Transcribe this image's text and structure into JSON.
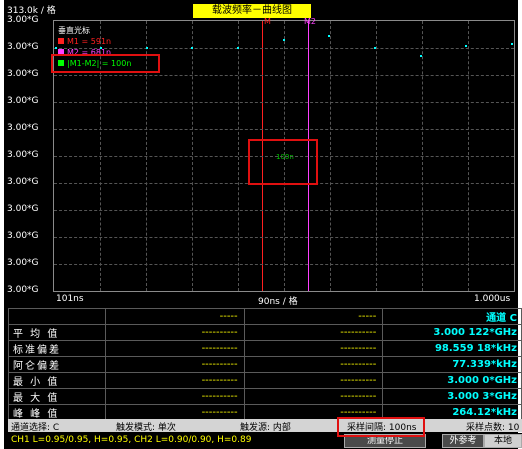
{
  "header": {
    "scale": "313.0k / 格",
    "title": "载波频率－曲线图"
  },
  "plot": {
    "y_tick_label": "3.00*G",
    "y_tick_count": 11,
    "x_ticks": {
      "left": "101ns",
      "center": "90ns / 格",
      "right": "1.000us"
    },
    "legend": {
      "title": "垂直光标",
      "items": [
        {
          "label": "M1 = 591n",
          "color": "#ff2020"
        },
        {
          "label": "M2 = 681n",
          "color": "#ff40ff"
        },
        {
          "label": "|M1-M2| = 100n",
          "color": "#00ff00"
        }
      ]
    },
    "delta_label": "100n",
    "marker_colors": {
      "m1": "#ff2020",
      "m2": "#ff40ff",
      "dots": "#00ffff"
    },
    "marker_tags": {
      "m1": "M",
      "m2": "M2"
    }
  },
  "chart_data": {
    "type": "scatter",
    "x": [
      101,
      190,
      280,
      370,
      460,
      550,
      640,
      730,
      820,
      910,
      1000
    ],
    "y": [
      3.000122,
      3.000122,
      3.000122,
      3.000122,
      3.000122,
      3.000126,
      3.000128,
      3.000122,
      3.000118,
      3.000123,
      3.000124
    ],
    "xlabel": "90ns / 格",
    "ylim": [
      3.0,
      3.000135
    ],
    "xlim": [
      101,
      1000
    ],
    "grid": true
  },
  "stats": {
    "channel_header": "通道 C",
    "rows": [
      {
        "label": "平 均 值",
        "c1": "----------",
        "c2": "----------",
        "c3": "3.000 122*GHz"
      },
      {
        "label": "标准偏差",
        "c1": "----------",
        "c2": "----------",
        "c3": "98.559 18*kHz"
      },
      {
        "label": "阿仑偏差",
        "c1": "----------",
        "c2": "----------",
        "c3": "77.339*kHz"
      },
      {
        "label": "最 小 值",
        "c1": "----------",
        "c2": "----------",
        "c3": "3.000 0*GHz"
      },
      {
        "label": "最 大 值",
        "c1": "----------",
        "c2": "----------",
        "c3": "3.000 3*GHz"
      },
      {
        "label": "峰 峰 值",
        "c1": "----------",
        "c2": "----------",
        "c3": "264.12*kHz"
      }
    ],
    "dash_top_c1": "-----",
    "dash_top_c2": "-----"
  },
  "status": {
    "channel_select": "通道选择: C",
    "trigger_mode": "触发模式: 单次",
    "trigger_source": "触发源: 内部",
    "sample_interval": "采样间隔: 100ns",
    "sample_points": "采样点数: 10",
    "thresholds": "CH1 L=0.95/0.95, H=0.95, CH2 L=0.90/0.90, H=0.89",
    "stop_button": "测量停止",
    "ext_ref": "外参考",
    "local": "本地"
  }
}
